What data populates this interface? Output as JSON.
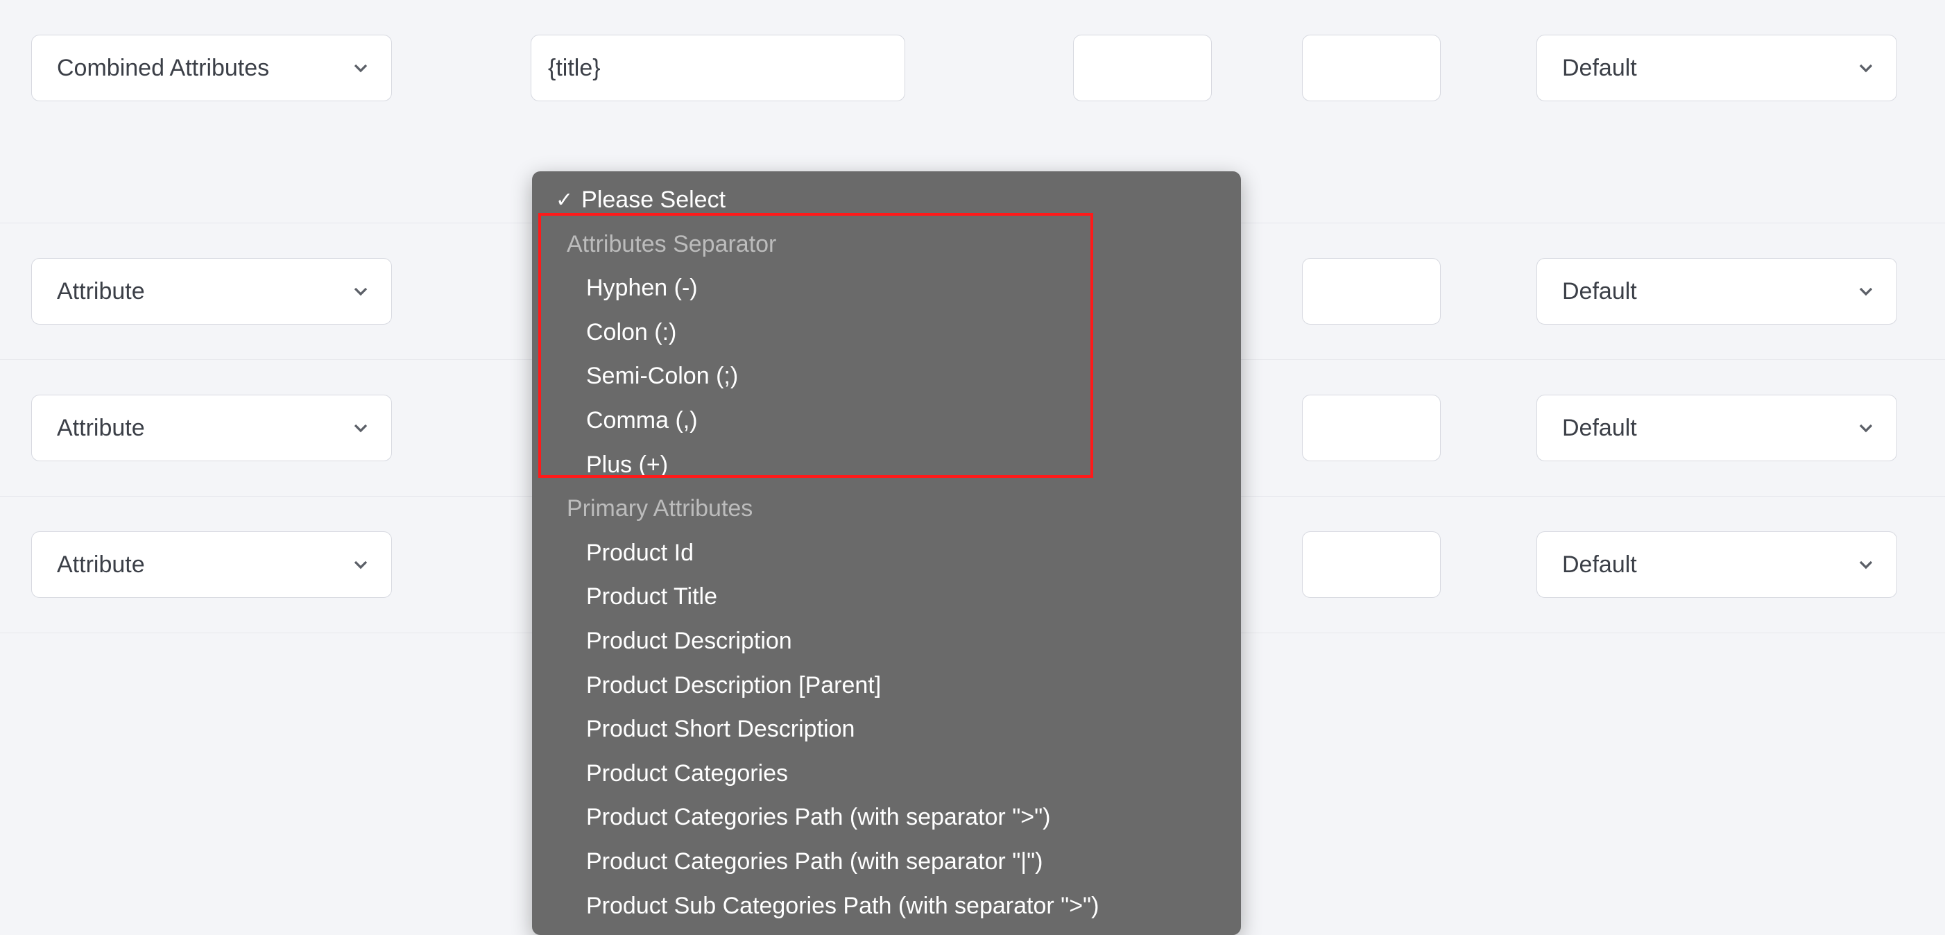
{
  "rows": [
    {
      "type_label": "Combined Attributes",
      "value": "{title}",
      "output_label": "Default"
    },
    {
      "type_label": "Attribute",
      "value": "",
      "output_label": "Default"
    },
    {
      "type_label": "Attribute",
      "value": "",
      "output_label": "Default"
    },
    {
      "type_label": "Attribute",
      "value": "",
      "output_label": "Default"
    }
  ],
  "dropdown": {
    "placeholder": "Please Select",
    "groups": [
      {
        "label": "Attributes Separator",
        "items": [
          "Hyphen (-)",
          "Colon (:)",
          "Semi-Colon (;)",
          "Comma (,)",
          "Plus (+)"
        ]
      },
      {
        "label": "Primary Attributes",
        "items": [
          "Product Id",
          "Product Title",
          "Product Description",
          "Product Description [Parent]",
          "Product Short Description",
          "Product Categories",
          "Product Categories Path (with separator \">\")",
          "Product Categories Path (with separator \"|\")",
          "Product Sub Categories Path (with separator \">\")"
        ]
      }
    ]
  }
}
